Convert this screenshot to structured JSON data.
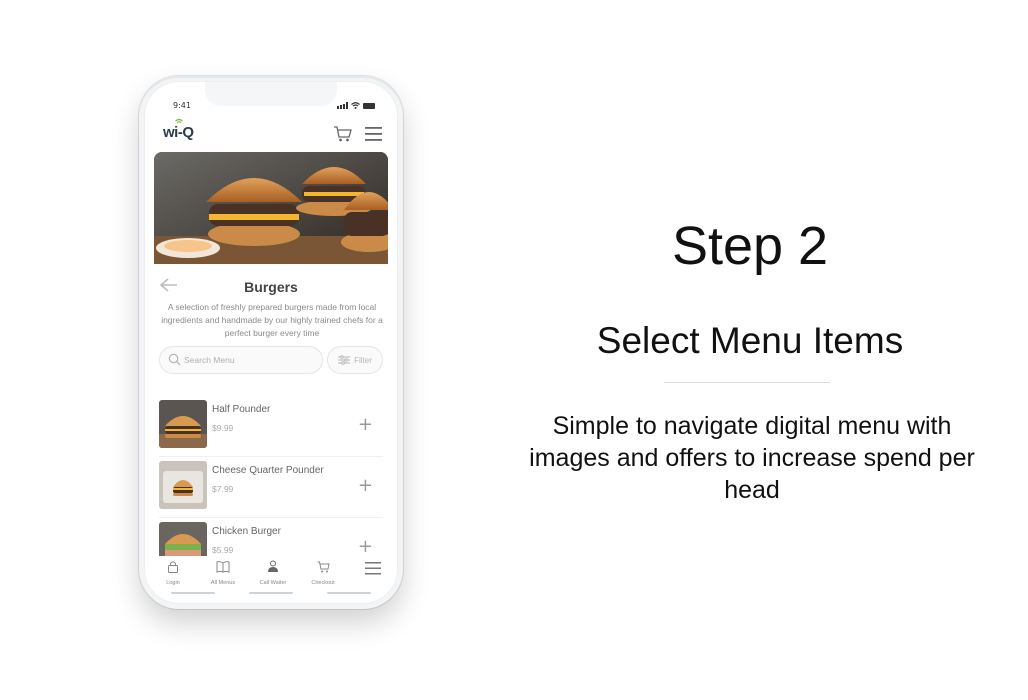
{
  "phone": {
    "status": {
      "time": "9:41"
    },
    "header": {
      "logo_text": "wi-Q",
      "cart_icon": "cart-icon",
      "menu_icon": "hamburger-icon"
    },
    "category": {
      "title": "Burgers",
      "description": "A selection of freshly prepared burgers made from local ingredients and handmade by our highly trained chefs for a perfect burger every time"
    },
    "search": {
      "placeholder": "Search Menu"
    },
    "filter": {
      "label": "Filter"
    },
    "items": [
      {
        "name": "Half Pounder",
        "price": "$9.99"
      },
      {
        "name": "Cheese Quarter Pounder",
        "price": "$7.99"
      },
      {
        "name": "Chicken Burger",
        "price": "$5.99"
      }
    ],
    "bottom_nav": [
      {
        "label": "Login",
        "icon": "lock-icon"
      },
      {
        "label": "All Menus",
        "icon": "book-icon"
      },
      {
        "label": "Call Waiter",
        "icon": "waiter-icon"
      },
      {
        "label": "Checkout",
        "icon": "cart-icon"
      },
      {
        "label": "",
        "icon": "hamburger-icon"
      }
    ]
  },
  "slide": {
    "step": "Step 2",
    "subtitle": "Select Menu Items",
    "description": "Simple to navigate digital menu with images and offers to increase spend per head"
  },
  "colors": {
    "brand": "#2b3d4f",
    "text_dark": "#111111",
    "muted": "#8a8a8a"
  }
}
